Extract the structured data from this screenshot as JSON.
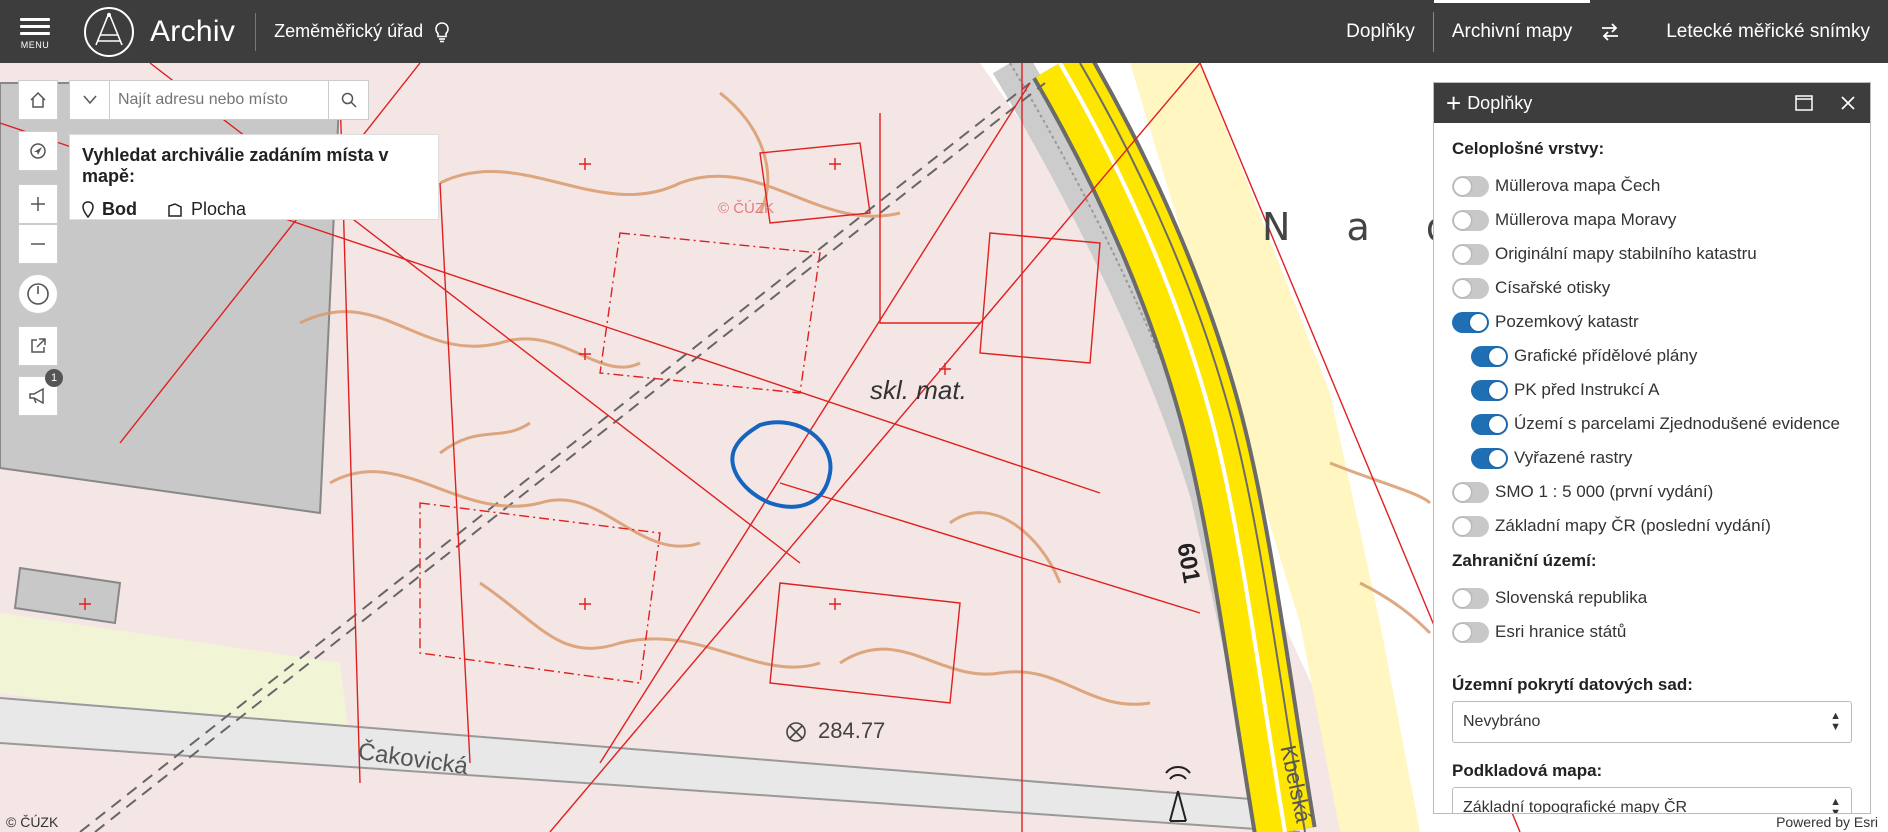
{
  "header": {
    "menu_label": "MENU",
    "app_title": "Archiv",
    "subtitle": "Zeměměřický úřad",
    "nav": [
      {
        "label": "Doplňky"
      },
      {
        "label": "Archivní mapy"
      },
      {
        "label": "Letecké měřické snímky"
      }
    ]
  },
  "search": {
    "placeholder": "Najít adresu nebo místo"
  },
  "find": {
    "title": "Vyhledat archiválie zadáním místa v mapě:",
    "opt_point": "Bod",
    "opt_area": "Plocha"
  },
  "tools": {
    "feedback_badge": "1"
  },
  "map": {
    "labels": {
      "nad": "N a d  V",
      "skl": "skl. mat.",
      "elevation": "284.77",
      "street": "Čakovická",
      "road_number": "601",
      "kbel": "Kbelská",
      "watermark": "© ČÚZK"
    },
    "attribution_left": "© ČÚZK",
    "attribution_right": "Powered by Esri"
  },
  "panel": {
    "title": "Doplňky",
    "section1_title": "Celoplošné vrstvy:",
    "layers": [
      {
        "label": "Müllerova mapa Čech",
        "on": false,
        "sub": false
      },
      {
        "label": "Müllerova mapa Moravy",
        "on": false,
        "sub": false
      },
      {
        "label": "Originální mapy stabilního katastru",
        "on": false,
        "sub": false
      },
      {
        "label": "Císařské otisky",
        "on": false,
        "sub": false
      },
      {
        "label": "Pozemkový katastr",
        "on": true,
        "sub": false
      },
      {
        "label": "Grafické přídělové plány",
        "on": true,
        "sub": true
      },
      {
        "label": "PK před Instrukcí A",
        "on": true,
        "sub": true
      },
      {
        "label": "Území s parcelami Zjednodušené evidence",
        "on": true,
        "sub": true
      },
      {
        "label": "Vyřazené rastry",
        "on": true,
        "sub": true
      },
      {
        "label": "SMO 1 : 5 000 (první vydání)",
        "on": false,
        "sub": false
      },
      {
        "label": "Základní mapy ČR (poslední vydání)",
        "on": false,
        "sub": false
      }
    ],
    "section2_title": "Zahraniční území:",
    "foreign_layers": [
      {
        "label": "Slovenská republika",
        "on": false
      },
      {
        "label": "Esri hranice států",
        "on": false
      }
    ],
    "coverage_label": "Územní pokrytí datových sad:",
    "coverage_value": "Nevybráno",
    "basemap_label": "Podkladová mapa:",
    "basemap_value": "Základní topografické mapy ČR"
  },
  "colors": {
    "header_bg": "#3d3d3d",
    "toggle_on": "#1f6fb5",
    "map_bg": "#f4e6e4",
    "road_yellow": "#ffe600",
    "cadastre_red": "#e02020",
    "contour": "#d99a6c",
    "marker_circle": "#1565c0"
  }
}
